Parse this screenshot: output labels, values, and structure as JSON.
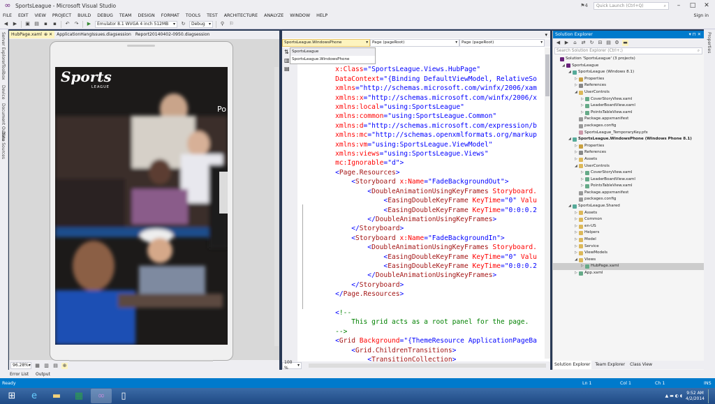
{
  "window": {
    "title": "SportsLeague - Microsoft Visual Studio",
    "quick_launch": "Quick Launch (Ctrl+Q)",
    "notifications": "4"
  },
  "menu": [
    "FILE",
    "EDIT",
    "VIEW",
    "PROJECT",
    "BUILD",
    "DEBUG",
    "TEAM",
    "DESIGN",
    "FORMAT",
    "TOOLS",
    "TEST",
    "ARCHITECTURE",
    "ANALYZE",
    "WINDOW",
    "HELP"
  ],
  "signin": "Sign in",
  "toolbar": {
    "run_target": "Emulator 8.1 WVGA 4 inch 512MB",
    "config": "Debug"
  },
  "left_strip": [
    "Server Explorer",
    "Toolbox",
    "Device",
    "Document Outline",
    "Data Sources"
  ],
  "right_strip": [
    "Properties"
  ],
  "doc_tabs": [
    {
      "label": "HubPage.xaml",
      "active": true
    },
    {
      "label": "ApplicationHangIssues.diagsession",
      "active": false
    },
    {
      "label": "Report20140402-0950.diagsession",
      "active": false
    }
  ],
  "designer": {
    "logo_text": "Sports",
    "logo_sub": "LEAGUE",
    "hub_header": "Po",
    "zoom": "96.28%"
  },
  "nav": {
    "project": "SportsLeague.WindowsPhone",
    "scope": "Page (pageRoot)",
    "member": "Page (pageRoot)",
    "dropdown_options": [
      "SportsLeague",
      "SportsLeague.WindowsPhone"
    ]
  },
  "editor": {
    "zoom": "100 %"
  },
  "code_lines": [
    [
      [
        "c-tag",
        "    pageRoot\""
      ]
    ],
    [
      [
        "c-attr",
        "    x:Class"
      ],
      [
        "c-blue",
        "=\"SportsLeague.Views.HubPage\""
      ]
    ],
    [
      [
        "c-attr",
        "    DataContext"
      ],
      [
        "c-blue",
        "=\"{Binding DefaultViewModel, RelativeSo"
      ]
    ],
    [
      [
        "c-attr",
        "    xmlns"
      ],
      [
        "c-blue",
        "=\"http://schemas.microsoft.com/winfx/2006/xam"
      ]
    ],
    [
      [
        "c-attr",
        "    xmlns:x"
      ],
      [
        "c-blue",
        "=\"http://schemas.microsoft.com/winfx/2006/x"
      ]
    ],
    [
      [
        "c-attr",
        "    xmlns:local"
      ],
      [
        "c-blue",
        "=\"using:SportsLeague\""
      ]
    ],
    [
      [
        "c-attr",
        "    xmlns:common"
      ],
      [
        "c-blue",
        "=\"using:SportsLeague.Common\""
      ]
    ],
    [
      [
        "c-attr",
        "    xmlns:d"
      ],
      [
        "c-blue",
        "=\"http://schemas.microsoft.com/expression/b"
      ]
    ],
    [
      [
        "c-attr",
        "    xmlns:mc"
      ],
      [
        "c-blue",
        "=\"http://schemas.openxmlformats.org/markup"
      ]
    ],
    [
      [
        "c-attr",
        "    xmlns:vm"
      ],
      [
        "c-blue",
        "=\"using:SportsLeague.ViewModel\""
      ]
    ],
    [
      [
        "c-attr",
        "    xmlns:views"
      ],
      [
        "c-blue",
        "=\"using:SportsLeague.Views\""
      ]
    ],
    [
      [
        "c-attr",
        "    mc:Ignorable"
      ],
      [
        "c-blue",
        "=\"d\">"
      ]
    ],
    [
      [
        "c-blue",
        "    <"
      ],
      [
        "c-tag",
        "Page.Resources"
      ],
      [
        "c-blue",
        ">"
      ]
    ],
    [
      [
        "c-blue",
        "        <"
      ],
      [
        "c-tag",
        "Storyboard"
      ],
      [
        "c-attr",
        " x:Name"
      ],
      [
        "c-blue",
        "=\"FadeBackgroundOut\">"
      ]
    ],
    [
      [
        "c-blue",
        "            <"
      ],
      [
        "c-tag",
        "DoubleAnimationUsingKeyFrames"
      ],
      [
        "c-attr",
        " Storyboard."
      ]
    ],
    [
      [
        "c-blue",
        "                <"
      ],
      [
        "c-tag",
        "EasingDoubleKeyFrame"
      ],
      [
        "c-attr",
        " KeyTime"
      ],
      [
        "c-blue",
        "=\"0\""
      ],
      [
        "c-attr",
        " Valu"
      ]
    ],
    [
      [
        "c-blue",
        "                <"
      ],
      [
        "c-tag",
        "EasingDoubleKeyFrame"
      ],
      [
        "c-attr",
        " KeyTime"
      ],
      [
        "c-blue",
        "=\"0:0:0.2"
      ]
    ],
    [
      [
        "c-blue",
        "            </"
      ],
      [
        "c-tag",
        "DoubleAnimationUsingKeyFrames"
      ],
      [
        "c-blue",
        ">"
      ]
    ],
    [
      [
        "c-blue",
        "        </"
      ],
      [
        "c-tag",
        "Storyboard"
      ],
      [
        "c-blue",
        ">"
      ]
    ],
    [
      [
        "c-blue",
        "        <"
      ],
      [
        "c-tag",
        "Storyboard"
      ],
      [
        "c-attr",
        " x:Name"
      ],
      [
        "c-blue",
        "=\"FadeBackgroundIn\">"
      ]
    ],
    [
      [
        "c-blue",
        "            <"
      ],
      [
        "c-tag",
        "DoubleAnimationUsingKeyFrames"
      ],
      [
        "c-attr",
        " Storyboard."
      ]
    ],
    [
      [
        "c-blue",
        "                <"
      ],
      [
        "c-tag",
        "EasingDoubleKeyFrame"
      ],
      [
        "c-attr",
        " KeyTime"
      ],
      [
        "c-blue",
        "=\"0\""
      ],
      [
        "c-attr",
        " Valu"
      ]
    ],
    [
      [
        "c-blue",
        "                <"
      ],
      [
        "c-tag",
        "EasingDoubleKeyFrame"
      ],
      [
        "c-attr",
        " KeyTime"
      ],
      [
        "c-blue",
        "=\"0:0:0.2"
      ]
    ],
    [
      [
        "c-blue",
        "            </"
      ],
      [
        "c-tag",
        "DoubleAnimationUsingKeyFrames"
      ],
      [
        "c-blue",
        ">"
      ]
    ],
    [
      [
        "c-blue",
        "        </"
      ],
      [
        "c-tag",
        "Storyboard"
      ],
      [
        "c-blue",
        ">"
      ]
    ],
    [
      [
        "c-blue",
        "    </"
      ],
      [
        "c-tag",
        "Page.Resources"
      ],
      [
        "c-blue",
        ">"
      ]
    ],
    [
      [
        "c-blue",
        ""
      ]
    ],
    [
      [
        "c-blue",
        "    <"
      ],
      [
        "c-com",
        "!--"
      ]
    ],
    [
      [
        "c-com",
        "        This grid acts as a root panel for the page."
      ]
    ],
    [
      [
        "c-com",
        "    -->"
      ]
    ],
    [
      [
        "c-blue",
        "    <"
      ],
      [
        "c-tag",
        "Grid"
      ],
      [
        "c-attr",
        " Background"
      ],
      [
        "c-blue",
        "=\"{ThemeResource ApplicationPageBa"
      ]
    ],
    [
      [
        "c-blue",
        "        <"
      ],
      [
        "c-tag",
        "Grid.ChildrenTransitions"
      ],
      [
        "c-blue",
        ">"
      ]
    ],
    [
      [
        "c-blue",
        "            <"
      ],
      [
        "c-tag",
        "TransitionCollection"
      ],
      [
        "c-blue",
        ">"
      ]
    ]
  ],
  "solution_explorer": {
    "title": "Solution Explorer",
    "search_placeholder": "Search Solution Explorer (Ctrl+;)",
    "tree": [
      {
        "d": 0,
        "t": "Solution 'SportsLeague' (3 projects)",
        "ic": "#68217a",
        "ar": ""
      },
      {
        "d": 1,
        "t": "SportsLeague",
        "ic": "#68217a",
        "ar": "◢"
      },
      {
        "d": 2,
        "t": "SportsLeague (Windows 8.1)",
        "ic": "#5a9",
        "ar": "◢"
      },
      {
        "d": 3,
        "t": "Properties",
        "ic": "#c8a040",
        "ar": "▷"
      },
      {
        "d": 3,
        "t": "References",
        "ic": "#888",
        "ar": "▷"
      },
      {
        "d": 3,
        "t": "UserControls",
        "ic": "#dcb85a",
        "ar": "◢"
      },
      {
        "d": 4,
        "t": "CoverStoryView.xaml",
        "ic": "#6a8",
        "ar": "▷"
      },
      {
        "d": 4,
        "t": "LeaderBoardView.xaml",
        "ic": "#6a8",
        "ar": "▷"
      },
      {
        "d": 4,
        "t": "PointsTableView.xaml",
        "ic": "#6a8",
        "ar": "▷"
      },
      {
        "d": 3,
        "t": "Package.appxmanifest",
        "ic": "#999",
        "ar": ""
      },
      {
        "d": 3,
        "t": "packages.config",
        "ic": "#999",
        "ar": ""
      },
      {
        "d": 3,
        "t": "SportsLeague_TemporaryKey.pfx",
        "ic": "#c9a",
        "ar": ""
      },
      {
        "d": 2,
        "t": "SportsLeague.WindowsPhone (Windows Phone 8.1)",
        "ic": "#5a9",
        "ar": "◢",
        "bold": true
      },
      {
        "d": 3,
        "t": "Properties",
        "ic": "#c8a040",
        "ar": "▷"
      },
      {
        "d": 3,
        "t": "References",
        "ic": "#888",
        "ar": "▷"
      },
      {
        "d": 3,
        "t": "Assets",
        "ic": "#dcb85a",
        "ar": "▷"
      },
      {
        "d": 3,
        "t": "UserControls",
        "ic": "#dcb85a",
        "ar": "◢"
      },
      {
        "d": 4,
        "t": "CoverStoryView.xaml",
        "ic": "#6a8",
        "ar": "▷"
      },
      {
        "d": 4,
        "t": "LeaderBoardView.xaml",
        "ic": "#6a8",
        "ar": "▷"
      },
      {
        "d": 4,
        "t": "PointsTableView.xaml",
        "ic": "#6a8",
        "ar": "▷"
      },
      {
        "d": 3,
        "t": "Package.appxmanifest",
        "ic": "#999",
        "ar": ""
      },
      {
        "d": 3,
        "t": "packages.config",
        "ic": "#999",
        "ar": ""
      },
      {
        "d": 2,
        "t": "SportsLeague.Shared",
        "ic": "#5a9",
        "ar": "◢"
      },
      {
        "d": 3,
        "t": "Assets",
        "ic": "#dcb85a",
        "ar": "▷"
      },
      {
        "d": 3,
        "t": "Common",
        "ic": "#dcb85a",
        "ar": "▷"
      },
      {
        "d": 3,
        "t": "en-US",
        "ic": "#dcb85a",
        "ar": "▷"
      },
      {
        "d": 3,
        "t": "Helpers",
        "ic": "#dcb85a",
        "ar": "▷"
      },
      {
        "d": 3,
        "t": "Model",
        "ic": "#dcb85a",
        "ar": "▷"
      },
      {
        "d": 3,
        "t": "Service",
        "ic": "#dcb85a",
        "ar": "▷"
      },
      {
        "d": 3,
        "t": "ViewModels",
        "ic": "#dcb85a",
        "ar": "▷"
      },
      {
        "d": 3,
        "t": "Views",
        "ic": "#dcb85a",
        "ar": "◢"
      },
      {
        "d": 4,
        "t": "HubPage.xaml",
        "ic": "#6a8",
        "ar": "▷",
        "sel": true
      },
      {
        "d": 3,
        "t": "App.xaml",
        "ic": "#6a8",
        "ar": "▷"
      }
    ],
    "tabs": [
      "Solution Explorer",
      "Team Explorer",
      "Class View"
    ]
  },
  "bottom_tabs": [
    "Error List",
    "Output"
  ],
  "status": {
    "text": "Ready",
    "ln": "Ln 1",
    "col": "Col 1",
    "ch": "Ch 1",
    "mode": "INS"
  },
  "clock": {
    "time": "9:52 AM",
    "date": "4/2/2014"
  },
  "colors": {
    "accent": "#007acc",
    "vs_purple": "#68217a"
  }
}
